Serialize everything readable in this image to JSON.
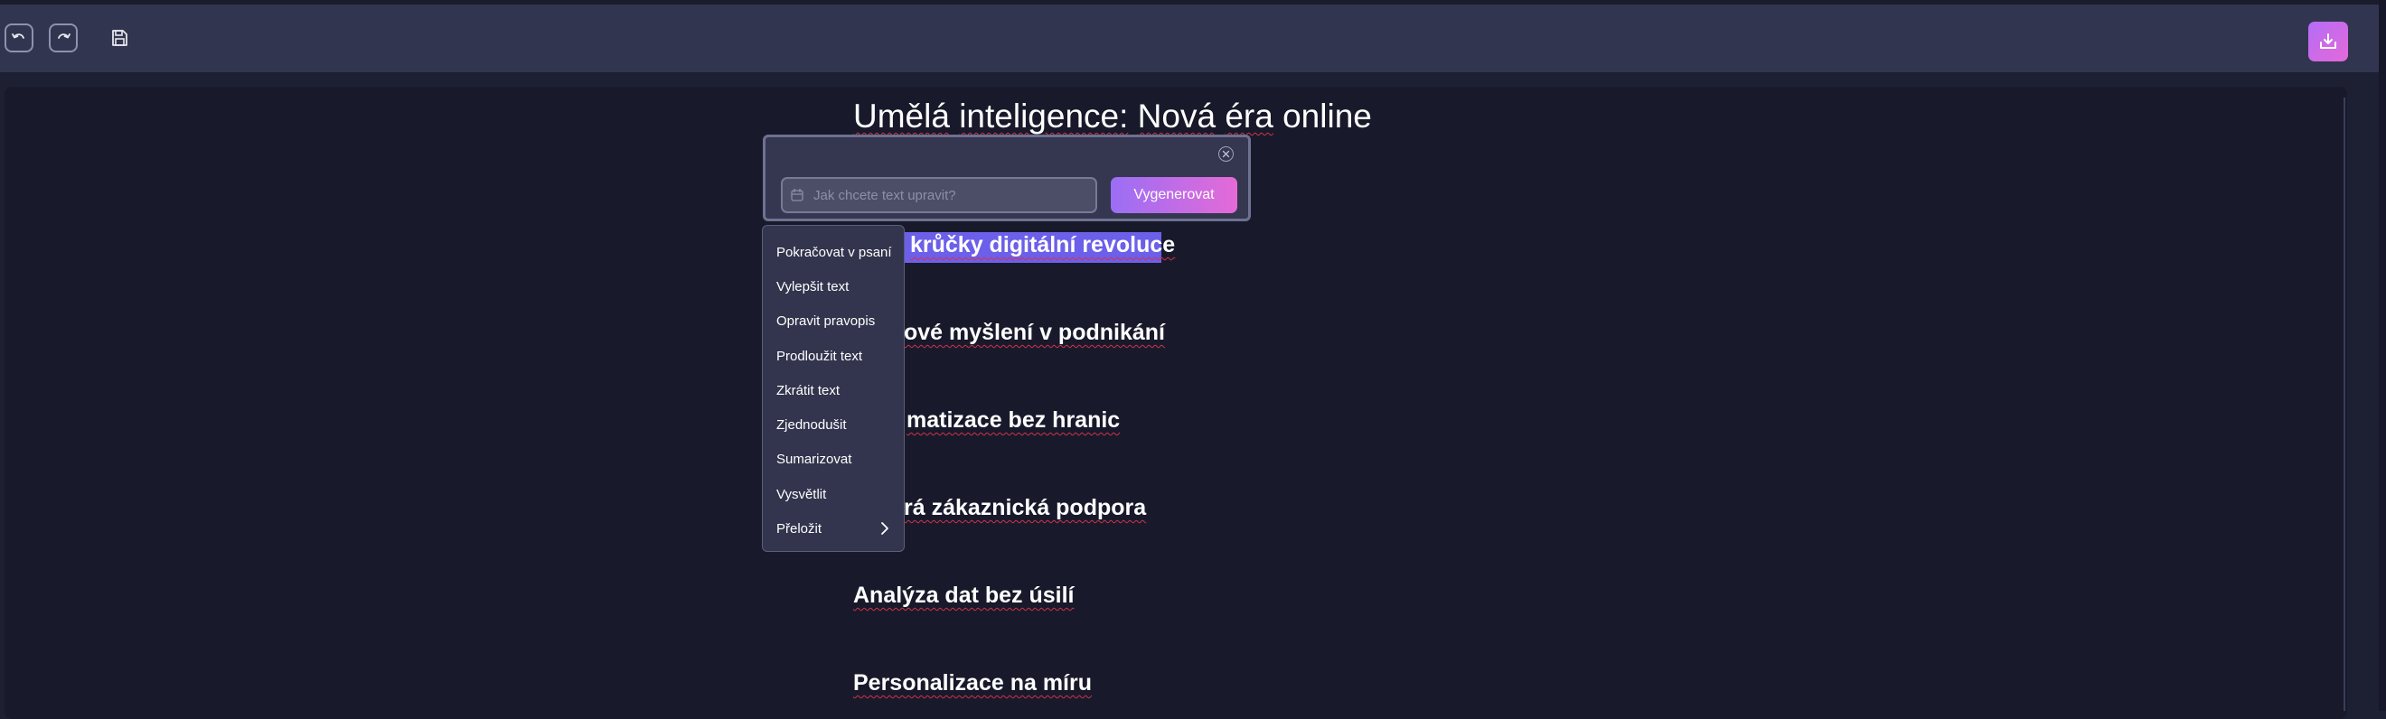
{
  "toolbar": {
    "undo_icon": "undo-icon",
    "redo_icon": "redo-icon",
    "save_icon": "save-icon",
    "export_icon": "download-icon"
  },
  "document": {
    "title_words": [
      "Umělá",
      "inteligence:",
      "Nová",
      "éra",
      "online"
    ],
    "headings": [
      {
        "visible_text": "krůčky digitální revoluce",
        "selected": true
      },
      {
        "visible_text": "ové myšlení v podnikání"
      },
      {
        "visible_text": "matizace bez hranic"
      },
      {
        "visible_text": "rá zákaznická podpora"
      },
      {
        "visible_text": "Analýza dat bez úsilí"
      },
      {
        "visible_text": "Personalizace na míru"
      }
    ]
  },
  "ai_popup": {
    "prompt_placeholder": "Jak chcete text upravit?",
    "prompt_value": "",
    "generate_label": "Vygenerovat",
    "close_icon": "close-icon",
    "prompt_icon": "sparkle-icon"
  },
  "menu": {
    "items": [
      {
        "label": "Pokračovat v psaní"
      },
      {
        "label": "Vylepšit text"
      },
      {
        "label": "Opravit pravopis"
      },
      {
        "label": "Prodloužit text"
      },
      {
        "label": "Zkrátit text"
      },
      {
        "label": "Zjednodušit"
      },
      {
        "label": "Sumarizovat"
      },
      {
        "label": "Vysvětlit"
      },
      {
        "label": "Přeložit",
        "has_submenu": true
      }
    ]
  },
  "colors": {
    "toolbar_bg": "#32354f",
    "editor_bg": "#181a2b",
    "selection": "#6c5fe9",
    "accent_gradient_start": "#9a6ef5",
    "accent_gradient_end": "#e56ad7",
    "spellcheck_underline": "#d2314a"
  }
}
